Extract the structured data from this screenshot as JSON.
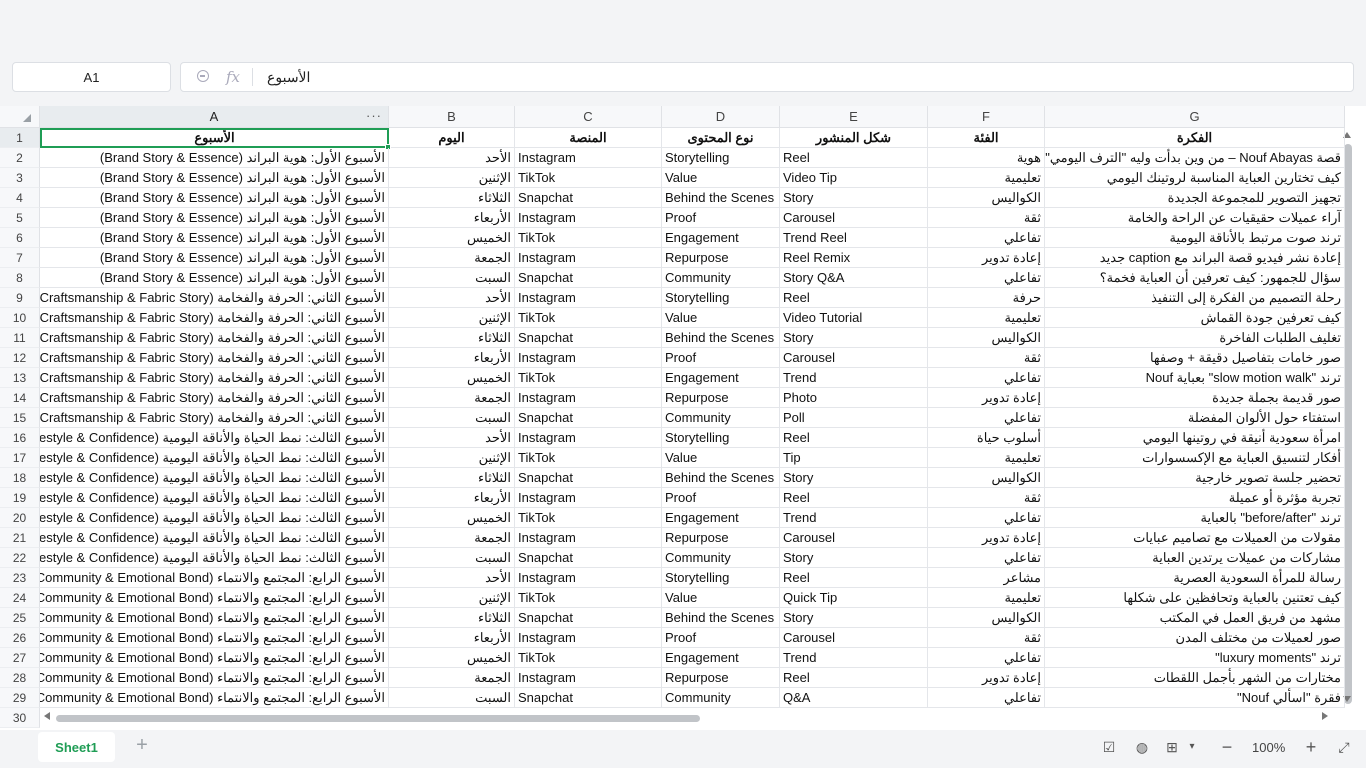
{
  "namebox": {
    "value": "A1"
  },
  "formula": {
    "value": "الأسبوع"
  },
  "columns": [
    "A",
    "B",
    "C",
    "D",
    "E",
    "F",
    "G"
  ],
  "row_numbers": [
    "1",
    "2",
    "3",
    "4",
    "5",
    "6",
    "7",
    "8",
    "9",
    "10",
    "11",
    "12",
    "13",
    "14",
    "15",
    "16",
    "17",
    "18",
    "19",
    "20",
    "21",
    "22",
    "23",
    "24",
    "25",
    "26",
    "27",
    "28",
    "29",
    "30"
  ],
  "header_row": [
    "الأسبوع",
    "اليوم",
    "المنصة",
    "نوع المحتوى",
    "شكل المنشور",
    "الفئة",
    "الفكرة"
  ],
  "rows": [
    [
      "الأسبوع الأول: هوية البراند (Brand Story & Essence)",
      "الأحد",
      "Instagram",
      "Storytelling",
      "Reel",
      "هوية",
      "قصة Nouf Abayas – من وين بدأت وليه \"الترف اليومي\""
    ],
    [
      "الأسبوع الأول: هوية البراند (Brand Story & Essence)",
      "الإثنين",
      "TikTok",
      "Value",
      "Video Tip",
      "تعليمية",
      "كيف تختارين العباية المناسبة لروتينك اليومي"
    ],
    [
      "الأسبوع الأول: هوية البراند (Brand Story & Essence)",
      "الثلاثاء",
      "Snapchat",
      "Behind the Scenes",
      "Story",
      "الكواليس",
      "تجهيز التصوير للمجموعة الجديدة"
    ],
    [
      "الأسبوع الأول: هوية البراند (Brand Story & Essence)",
      "الأربعاء",
      "Instagram",
      "Proof",
      "Carousel",
      "ثقة",
      "آراء عميلات حقيقيات عن الراحة والخامة"
    ],
    [
      "الأسبوع الأول: هوية البراند (Brand Story & Essence)",
      "الخميس",
      "TikTok",
      "Engagement",
      "Trend Reel",
      "تفاعلي",
      "ترند صوت مرتبط بالأناقة اليومية"
    ],
    [
      "الأسبوع الأول: هوية البراند (Brand Story & Essence)",
      "الجمعة",
      "Instagram",
      "Repurpose",
      "Reel Remix",
      "إعادة تدوير",
      "إعادة نشر فيديو قصة البراند مع caption جديد"
    ],
    [
      "الأسبوع الأول: هوية البراند (Brand Story & Essence)",
      "السبت",
      "Snapchat",
      "Community",
      "Story Q&A",
      "تفاعلي",
      "سؤال للجمهور: كيف تعرفين أن العباية فخمة؟"
    ],
    [
      "الأسبوع الثاني: الحرفة والفخامة (Craftsmanship & Fabric Story)",
      "الأحد",
      "Instagram",
      "Storytelling",
      "Reel",
      "حرفة",
      "رحلة التصميم من الفكرة إلى التنفيذ"
    ],
    [
      "الأسبوع الثاني: الحرفة والفخامة (Craftsmanship & Fabric Story)",
      "الإثنين",
      "TikTok",
      "Value",
      "Video Tutorial",
      "تعليمية",
      "كيف تعرفين جودة القماش"
    ],
    [
      "الأسبوع الثاني: الحرفة والفخامة (Craftsmanship & Fabric Story)",
      "الثلاثاء",
      "Snapchat",
      "Behind the Scenes",
      "Story",
      "الكواليس",
      "تغليف الطلبات الفاخرة"
    ],
    [
      "الأسبوع الثاني: الحرفة والفخامة (Craftsmanship & Fabric Story)",
      "الأربعاء",
      "Instagram",
      "Proof",
      "Carousel",
      "ثقة",
      "صور خامات بتفاصيل دقيقة + وصفها"
    ],
    [
      "الأسبوع الثاني: الحرفة والفخامة (Craftsmanship & Fabric Story)",
      "الخميس",
      "TikTok",
      "Engagement",
      "Trend",
      "تفاعلي",
      "ترند \"slow motion walk\" بعباية Nouf"
    ],
    [
      "الأسبوع الثاني: الحرفة والفخامة (Craftsmanship & Fabric Story)",
      "الجمعة",
      "Instagram",
      "Repurpose",
      "Photo",
      "إعادة تدوير",
      "صور قديمة بجملة جديدة"
    ],
    [
      "الأسبوع الثاني: الحرفة والفخامة (Craftsmanship & Fabric Story)",
      "السبت",
      "Snapchat",
      "Community",
      "Poll",
      "تفاعلي",
      "استفتاء حول الألوان المفضلة"
    ],
    [
      "الأسبوع الثالث: نمط الحياة والأناقة اليومية (Lifestyle & Confidence)",
      "الأحد",
      "Instagram",
      "Storytelling",
      "Reel",
      "أسلوب حياة",
      "امرأة سعودية أنيقة في روتينها اليومي"
    ],
    [
      "الأسبوع الثالث: نمط الحياة والأناقة اليومية (Lifestyle & Confidence)",
      "الإثنين",
      "TikTok",
      "Value",
      "Tip",
      "تعليمية",
      "أفكار لتنسيق العباية مع الإكسسوارات"
    ],
    [
      "الأسبوع الثالث: نمط الحياة والأناقة اليومية (Lifestyle & Confidence)",
      "الثلاثاء",
      "Snapchat",
      "Behind the Scenes",
      "Story",
      "الكواليس",
      "تحضير جلسة تصوير خارجية"
    ],
    [
      "الأسبوع الثالث: نمط الحياة والأناقة اليومية (Lifestyle & Confidence)",
      "الأربعاء",
      "Instagram",
      "Proof",
      "Reel",
      "ثقة",
      "تجربة مؤثرة أو عميلة"
    ],
    [
      "الأسبوع الثالث: نمط الحياة والأناقة اليومية (Lifestyle & Confidence)",
      "الخميس",
      "TikTok",
      "Engagement",
      "Trend",
      "تفاعلي",
      "ترند \"before/after\" بالعباية"
    ],
    [
      "الأسبوع الثالث: نمط الحياة والأناقة اليومية (Lifestyle & Confidence)",
      "الجمعة",
      "Instagram",
      "Repurpose",
      "Carousel",
      "إعادة تدوير",
      "مقولات من العميلات مع تصاميم عبايات"
    ],
    [
      "الأسبوع الثالث: نمط الحياة والأناقة اليومية (Lifestyle & Confidence)",
      "السبت",
      "Snapchat",
      "Community",
      "Story",
      "تفاعلي",
      "مشاركات من عميلات يرتدين العباية"
    ],
    [
      "الأسبوع الرابع: المجتمع والانتماء (Community & Emotional Bond)",
      "الأحد",
      "Instagram",
      "Storytelling",
      "Reel",
      "مشاعر",
      "رسالة للمرأة السعودية العصرية"
    ],
    [
      "الأسبوع الرابع: المجتمع والانتماء (Community & Emotional Bond)",
      "الإثنين",
      "TikTok",
      "Value",
      "Quick Tip",
      "تعليمية",
      "كيف تعتنين بالعباية وتحافظين على شكلها"
    ],
    [
      "الأسبوع الرابع: المجتمع والانتماء (Community & Emotional Bond)",
      "الثلاثاء",
      "Snapchat",
      "Behind the Scenes",
      "Story",
      "الكواليس",
      "مشهد من فريق العمل في المكتب"
    ],
    [
      "الأسبوع الرابع: المجتمع والانتماء (Community & Emotional Bond)",
      "الأربعاء",
      "Instagram",
      "Proof",
      "Carousel",
      "ثقة",
      "صور لعميلات من مختلف المدن"
    ],
    [
      "الأسبوع الرابع: المجتمع والانتماء (Community & Emotional Bond)",
      "الخميس",
      "TikTok",
      "Engagement",
      "Trend",
      "تفاعلي",
      "ترند \"luxury moments\""
    ],
    [
      "الأسبوع الرابع: المجتمع والانتماء (Community & Emotional Bond)",
      "الجمعة",
      "Instagram",
      "Repurpose",
      "Reel",
      "إعادة تدوير",
      "مختارات من الشهر بأجمل اللقطات"
    ],
    [
      "الأسبوع الرابع: المجتمع والانتماء (Community & Emotional Bond)",
      "السبت",
      "Snapchat",
      "Community",
      "Q&A",
      "تفاعلي",
      "فقرة \"اسألي Nouf\""
    ]
  ],
  "sheet_tab": {
    "label": "Sheet1"
  },
  "statusbar": {
    "zoom": "100%"
  },
  "accent_color": "#1f9d55"
}
